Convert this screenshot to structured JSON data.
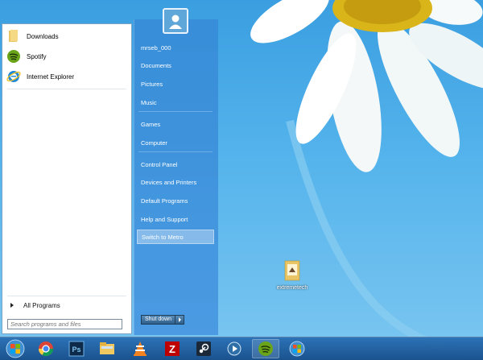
{
  "start_menu": {
    "pinned": [
      {
        "label": "Downloads",
        "icon": "folder-icon"
      },
      {
        "label": "Spotify",
        "icon": "spotify-icon"
      },
      {
        "label": "Internet Explorer",
        "icon": "ie-icon"
      }
    ],
    "all_programs_label": "All Programs",
    "search_placeholder": "Search programs and files",
    "user_name": "mrseb_000",
    "right_items": [
      {
        "label": "Documents"
      },
      {
        "label": "Pictures"
      },
      {
        "label": "Music"
      },
      {
        "label": "Games"
      },
      {
        "label": "Computer"
      },
      {
        "label": "Control Panel"
      },
      {
        "label": "Devices and Printers"
      },
      {
        "label": "Default Programs"
      },
      {
        "label": "Help and Support"
      },
      {
        "label": "Switch to Metro"
      }
    ],
    "shutdown_label": "Shut down"
  },
  "desktop": {
    "icon_label": "extremetech"
  },
  "taskbar": {
    "items": [
      "start-orb-icon",
      "chrome-icon",
      "photoshop-icon",
      "explorer-icon",
      "vlc-icon",
      "filezilla-icon",
      "steam-icon",
      "media-player-icon",
      "spotify-icon",
      "start-orb-icon"
    ]
  }
}
